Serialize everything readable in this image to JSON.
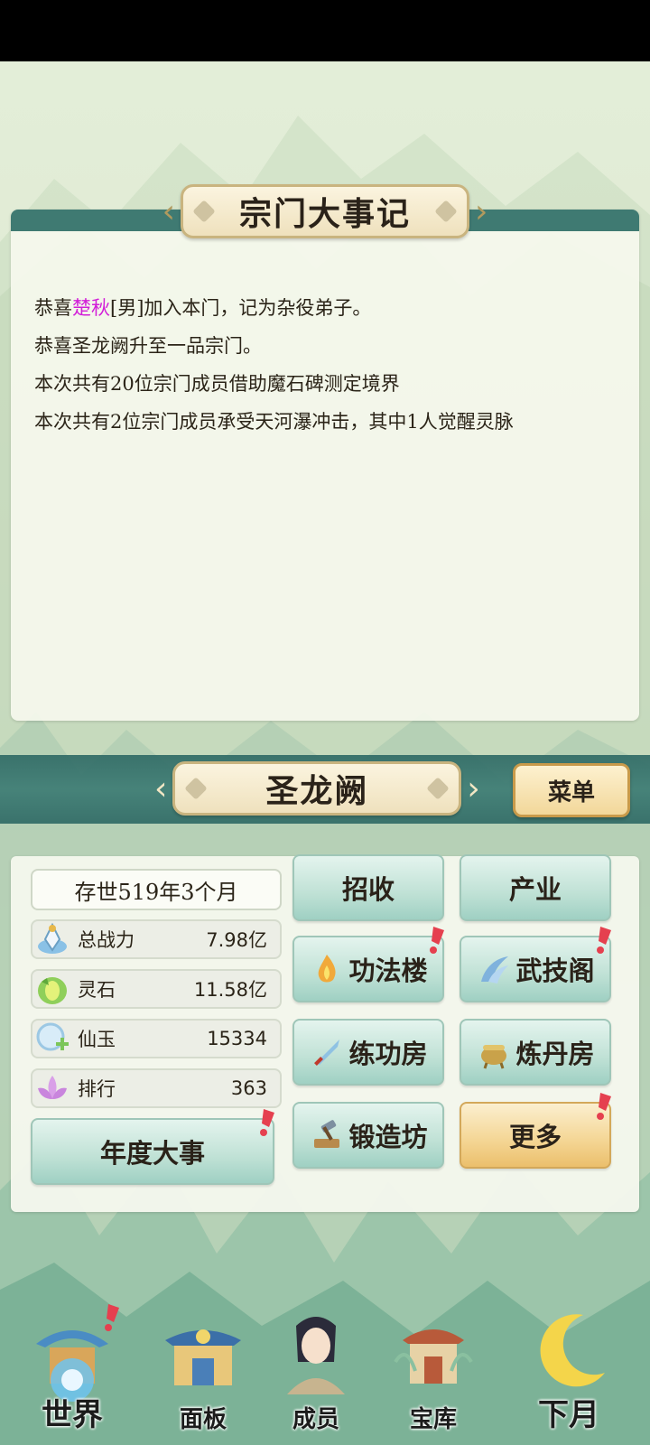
{
  "chronicle": {
    "title": "宗门大事记",
    "entries": [
      {
        "prefix": "恭喜",
        "name": "楚秋",
        "suffix": "[男]加入本门，记为杂役弟子。"
      },
      {
        "prefix": "恭喜圣龙阙升至一品宗门。",
        "name": "",
        "suffix": ""
      },
      {
        "prefix": "本次共有20位宗门成员借助魔石碑测定境界",
        "name": "",
        "suffix": ""
      },
      {
        "prefix": "本次共有2位宗门成员承受天河瀑冲击，其中1人觉醒灵脉",
        "name": "",
        "suffix": ""
      }
    ]
  },
  "sect": {
    "name": "圣龙阙",
    "menu_label": "菜单",
    "era": "存世519年3个月",
    "stats": [
      {
        "icon": "combat-power-icon",
        "label": "总战力",
        "value": "7.98亿"
      },
      {
        "icon": "spirit-stone-icon",
        "label": "灵石",
        "value": "11.58亿"
      },
      {
        "icon": "immortal-jade-icon",
        "label": "仙玉",
        "value": "15334"
      },
      {
        "icon": "ranking-lotus-icon",
        "label": "排行",
        "value": "363"
      }
    ],
    "annual_events_label": "年度大事"
  },
  "tiles": {
    "recruit": "招收",
    "industry": "产业",
    "technique_tower": "功法楼",
    "martial_pavilion": "武技阁",
    "training_room": "练功房",
    "alchemy_room": "炼丹房",
    "forge": "锻造坊",
    "more": "更多"
  },
  "nav": {
    "world": "世界",
    "panel": "面板",
    "members": "成员",
    "treasury": "宝库",
    "next_month": "下月"
  },
  "colors": {
    "accent_teal": "#3f7a72",
    "highlight_name": "#d21fd8",
    "badge_red": "#e5404f",
    "gold": "#f2d79a"
  }
}
